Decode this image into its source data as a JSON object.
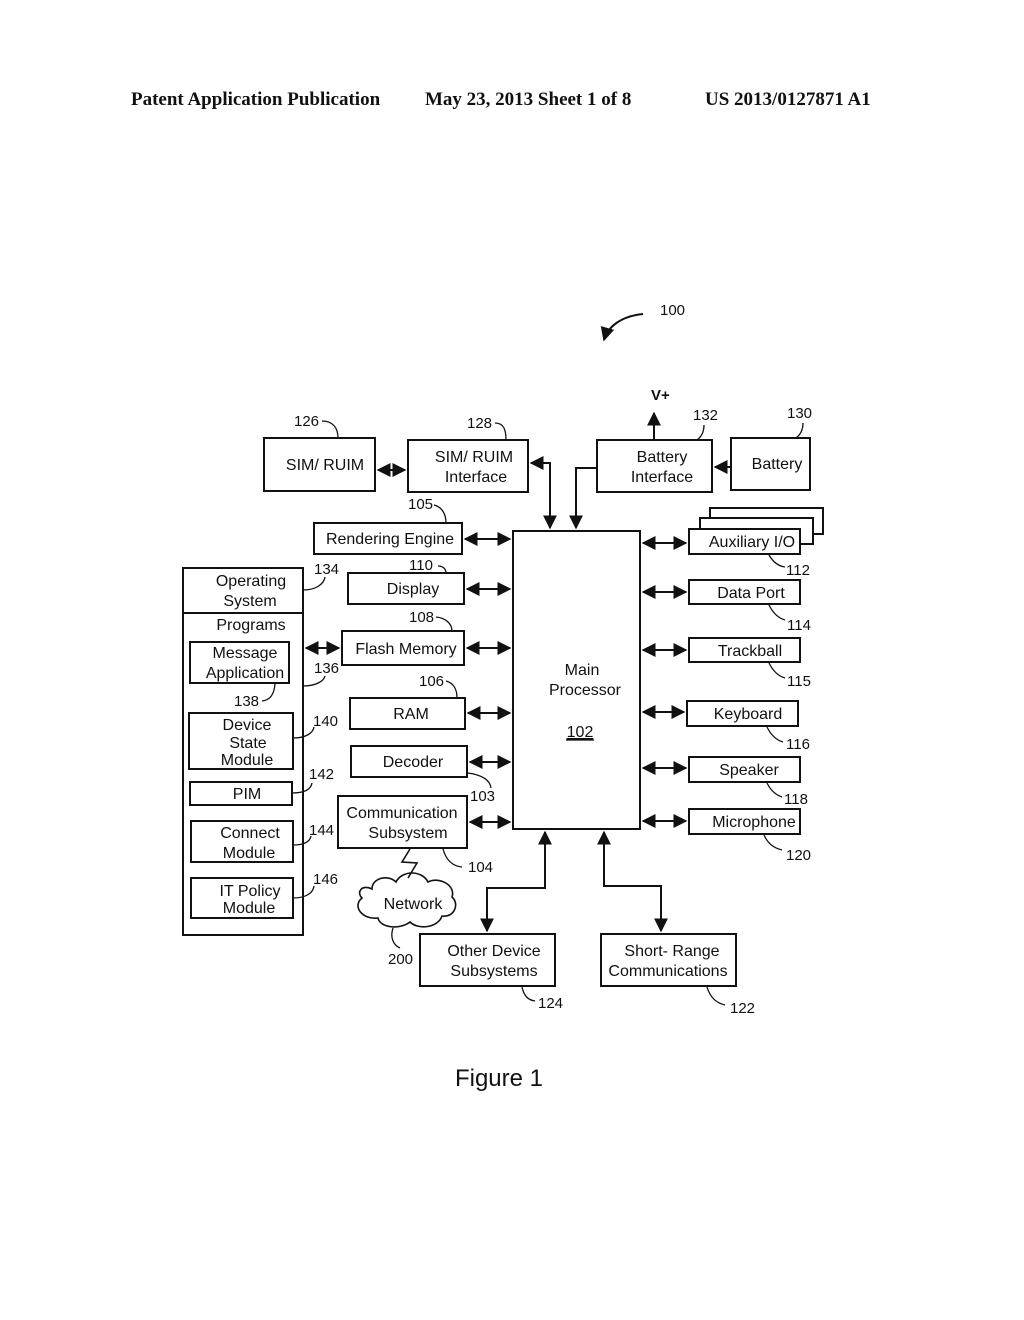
{
  "header": {
    "left": "Patent Application Publication",
    "middle": "May 23, 2013  Sheet 1 of 8",
    "right": "US 2013/0127871 A1"
  },
  "figure": {
    "ref": "100",
    "caption": "Figure 1",
    "vplus": "V+",
    "main_processor": {
      "line1": "Main",
      "line2": "Processor",
      "ref": "102"
    },
    "sim_ruim": {
      "label": "SIM/ RUIM",
      "ref": "126"
    },
    "sim_ruim_interface": {
      "line1": "SIM/ RUIM",
      "line2": "Interface",
      "ref": "128"
    },
    "battery_interface": {
      "line1": "Battery",
      "line2": "Interface",
      "ref": "132"
    },
    "battery": {
      "label": "Battery",
      "ref": "130"
    },
    "rendering_engine": {
      "label": "Rendering Engine",
      "ref": "105"
    },
    "display": {
      "label": "Display",
      "ref": "110"
    },
    "flash_memory": {
      "label": "Flash Memory",
      "ref": "108"
    },
    "ram": {
      "label": "RAM",
      "ref": "106"
    },
    "decoder": {
      "label": "Decoder",
      "ref": "103"
    },
    "comm_subsystem": {
      "line1": "Communication",
      "line2": "Subsystem",
      "ref": "104"
    },
    "network": {
      "label": "Network",
      "ref": "200"
    },
    "other_device": {
      "line1": "Other Device",
      "line2": "Subsystems",
      "ref": "124"
    },
    "short_range": {
      "line1": "Short- Range",
      "line2": "Communications",
      "ref": "122"
    },
    "aux_io": {
      "label": "Auxiliary I/O",
      "ref": "112"
    },
    "data_port": {
      "label": "Data Port",
      "ref": "114"
    },
    "trackball": {
      "label": "Trackball",
      "ref": "115"
    },
    "keyboard": {
      "label": "Keyboard",
      "ref": "116"
    },
    "speaker": {
      "label": "Speaker",
      "ref": "118"
    },
    "microphone": {
      "label": "Microphone",
      "ref": "120"
    },
    "operating_system": {
      "line1": "Operating",
      "line2": "System",
      "ref": "134"
    },
    "programs": {
      "label": "Programs",
      "ref": "136"
    },
    "message_app": {
      "line1": "Message",
      "line2": "Application",
      "ref": "138"
    },
    "device_state": {
      "line1": "Device",
      "line2": "State",
      "line3": "Module",
      "ref": "140"
    },
    "pim": {
      "label": "PIM",
      "ref": "142"
    },
    "connect_module": {
      "line1": "Connect",
      "line2": "Module",
      "ref": "144"
    },
    "it_policy": {
      "line1": "IT Policy",
      "line2": "Module",
      "ref": "146"
    }
  }
}
